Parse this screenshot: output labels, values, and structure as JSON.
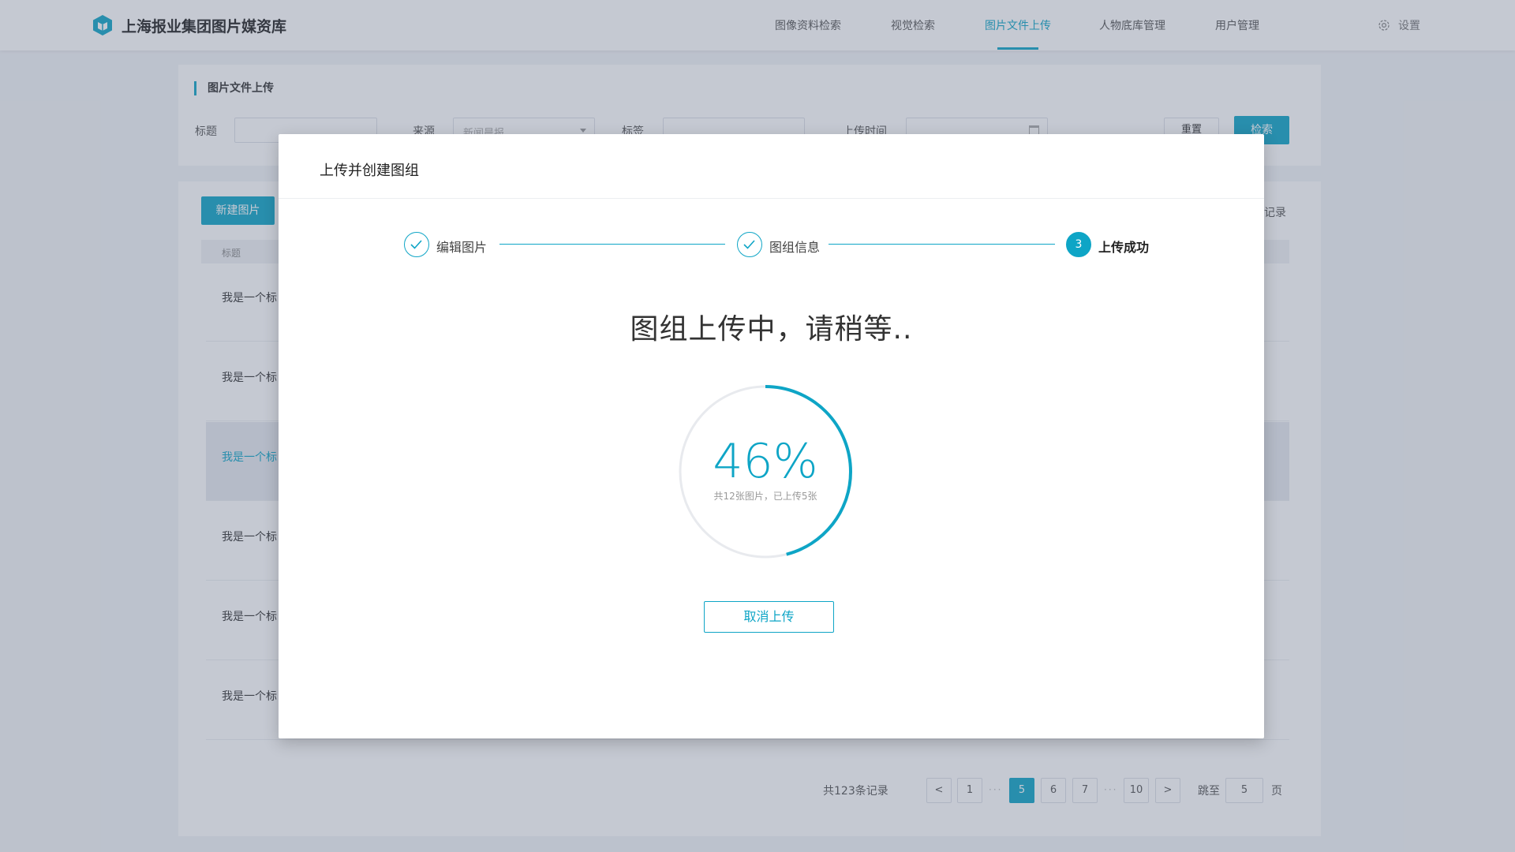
{
  "app": {
    "brand": "上海报业集团图片媒资库",
    "nav": [
      "图像资料检索",
      "视觉检索",
      "图片文件上传",
      "人物底库管理",
      "用户管理"
    ],
    "active_nav": "图片文件上传",
    "settings_label": "设置"
  },
  "filter": {
    "section_title": "图片文件上传",
    "title_label": "标题",
    "source_label": "来源",
    "source_value": "新闻晨报",
    "tags_label": "标签",
    "time_label": "上传时间",
    "reset_label": "重置",
    "search_label": "检索"
  },
  "list": {
    "new_button": "新建图片",
    "total_suffix": "记录",
    "column_title": "标题",
    "rows": [
      "我是一个标",
      "我是一个标",
      "我是一个标",
      "我是一个标",
      "我是一个标",
      "我是一个标"
    ]
  },
  "pagination": {
    "total": "共123条记录",
    "pages": [
      "1",
      "5",
      "6",
      "7",
      "10"
    ],
    "current": "5",
    "jump_label": "跳至",
    "jump_value": "5",
    "page_suffix": "页",
    "prev": "<",
    "next": ">"
  },
  "modal": {
    "title": "上传并创建图组",
    "steps": [
      {
        "label": "编辑图片",
        "status": "done"
      },
      {
        "label": "图组信息",
        "status": "done"
      },
      {
        "label": "上传成功",
        "status": "current",
        "number": "3"
      }
    ],
    "headline": "图组上传中，请稍等..",
    "progress": {
      "percent_label": "46%",
      "value": 0.46,
      "note": "共12张图片，已上传5张"
    },
    "cancel_label": "取消上传"
  },
  "colors": {
    "accent": "#0ea5c6",
    "overlay": "rgba(90,100,125,0.35)"
  }
}
